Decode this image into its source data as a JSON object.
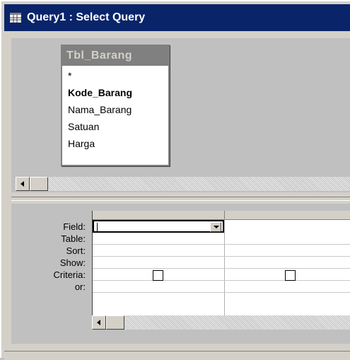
{
  "window": {
    "title": "Query1 : Select Query"
  },
  "table_box": {
    "name": "Tbl_Barang",
    "fields": [
      "*",
      "Kode_Barang",
      "Nama_Barang",
      "Satuan",
      "Harga"
    ],
    "key_field": "Kode_Barang"
  },
  "design_grid": {
    "row_labels": [
      "Field:",
      "Table:",
      "Sort:",
      "Show:",
      "Criteria:",
      "or:"
    ],
    "columns": [
      {
        "field": "",
        "table": "",
        "sort": "",
        "show": false,
        "criteria": "",
        "or": ""
      },
      {
        "field": "",
        "table": "",
        "sort": "",
        "show": false,
        "criteria": "",
        "or": ""
      }
    ]
  },
  "icons": {
    "title_icon": "query-grid-icon",
    "scroll_left": "arrow-left-icon",
    "dropdown": "chevron-down-icon"
  },
  "colors": {
    "titlebar": "#0a246a",
    "pane_bg": "#c0c0c0",
    "table_caption": "#808080"
  }
}
